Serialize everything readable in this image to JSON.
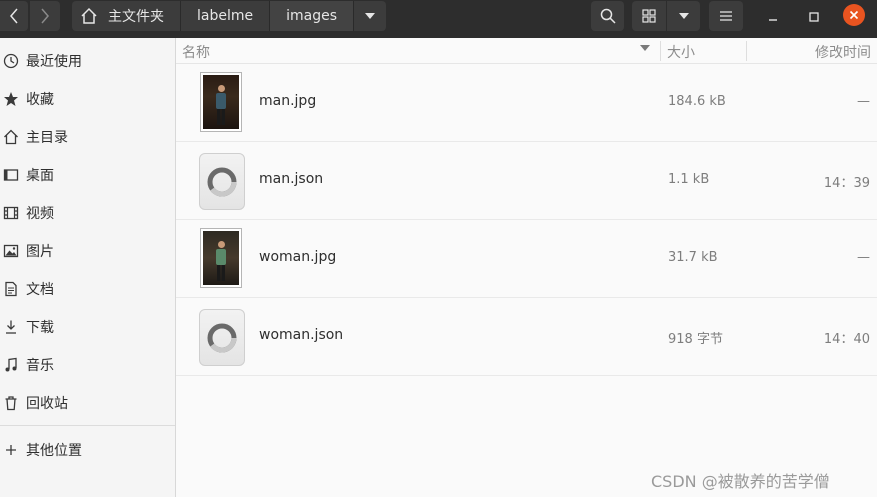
{
  "header": {
    "back_icon": "chevron-left-icon",
    "forward_icon": "chevron-right-icon",
    "breadcrumbs": [
      "主文件夹",
      "labelme",
      "images"
    ],
    "search_icon": "search-icon",
    "view_icon": "grid-icon",
    "menu_icon": "hamburger-icon",
    "minimize": "—",
    "maximize": "□",
    "close": "✕"
  },
  "sidebar": {
    "items": [
      {
        "label": "最近使用",
        "icon": "clock-icon"
      },
      {
        "label": "收藏",
        "icon": "star-icon"
      },
      {
        "label": "主目录",
        "icon": "home-icon"
      },
      {
        "label": "桌面",
        "icon": "desktop-icon"
      },
      {
        "label": "视频",
        "icon": "film-icon"
      },
      {
        "label": "图片",
        "icon": "image-icon"
      },
      {
        "label": "文档",
        "icon": "document-icon"
      },
      {
        "label": "下载",
        "icon": "download-icon"
      },
      {
        "label": "音乐",
        "icon": "music-icon"
      },
      {
        "label": "回收站",
        "icon": "trash-icon"
      }
    ],
    "other": {
      "label": "其他位置",
      "icon": "plus-icon"
    }
  },
  "columns": {
    "name": "名称",
    "size": "大小",
    "modified": "修改时间"
  },
  "files": [
    {
      "name": "man.jpg",
      "size": "184.6 kB",
      "modified": "—",
      "kind": "image"
    },
    {
      "name": "man.json",
      "size": "1.1 kB",
      "modified": "14：39",
      "kind": "json"
    },
    {
      "name": "woman.jpg",
      "size": "31.7 kB",
      "modified": "—",
      "kind": "image"
    },
    {
      "name": "woman.json",
      "size": "918 字节",
      "modified": "14：40",
      "kind": "json"
    }
  ],
  "watermark": "CSDN @被散养的苦学僧",
  "colors": {
    "accent": "#e95420",
    "headerbar": "#2d2d2d"
  }
}
